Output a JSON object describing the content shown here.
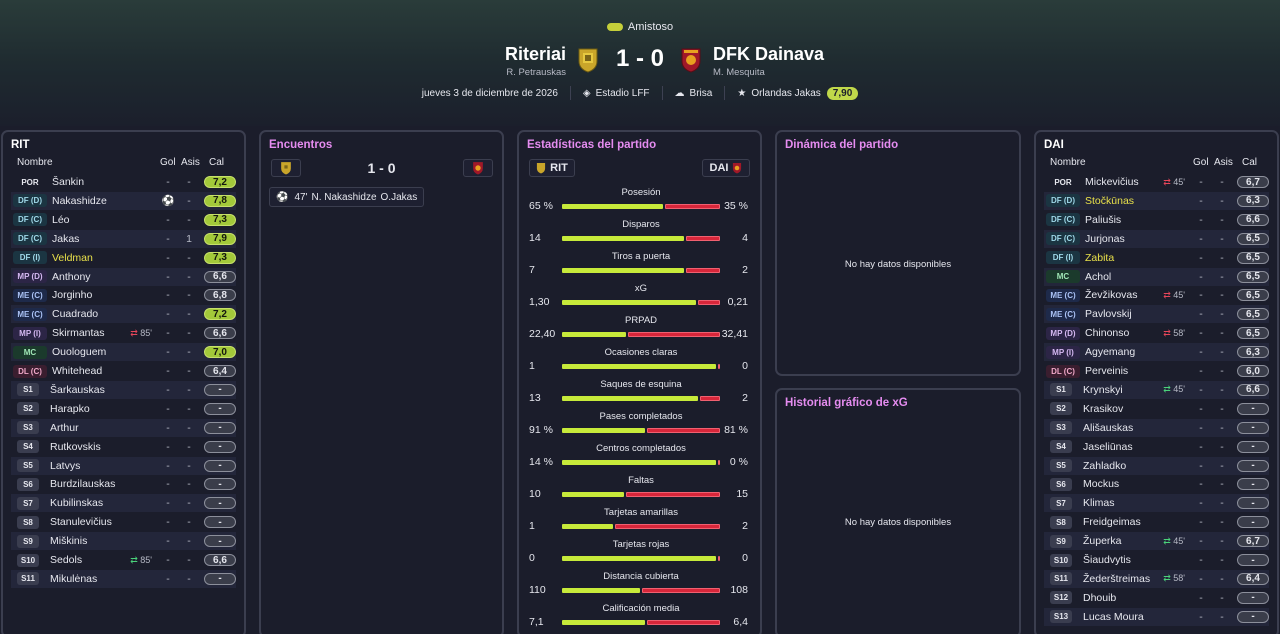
{
  "match": {
    "competition": "Amistoso",
    "home": {
      "name": "Riteriai",
      "manager": "R. Petrauskas",
      "short": "RIT"
    },
    "away": {
      "name": "DFK Dainava",
      "manager": "M. Mesquita",
      "short": "DAI"
    },
    "score": "1 - 0",
    "date": "jueves 3 de diciembre de 2026",
    "stadium": "Estadio LFF",
    "weather": "Brisa",
    "potm_name": "Orlandas Jakas",
    "potm_rating": "7,90"
  },
  "colors": {
    "accent": "#c7ea3a",
    "danger": "#d8263a",
    "title_pink": "#e58cf0"
  },
  "headers": {
    "name": "Nombre",
    "goals": "Gol",
    "assists": "Asis",
    "rating": "Cal"
  },
  "panels": {
    "home_title": "RIT",
    "away_title": "DAI",
    "events_title": "Encuentros",
    "stats_title": "Estadísticas del partido",
    "dynamics_title": "Dinámica del partido",
    "xg_title": "Historial gráfico de xG",
    "no_data": "No hay datos disponibles"
  },
  "events": {
    "score": "1 - 0",
    "items": [
      {
        "minute": "47'",
        "scorer": "N. Nakashidze",
        "assist": "O.Jakas"
      }
    ]
  },
  "home_players": [
    {
      "pos": "POR",
      "name": "Šankin",
      "goals": "-",
      "assists": "-",
      "rating": "7,2"
    },
    {
      "pos": "DF (D)",
      "name": "Nakashidze",
      "goals": "",
      "assists": "-",
      "rating": "7,8",
      "goal_icon": true
    },
    {
      "pos": "DF (C)",
      "name": "Léo",
      "goals": "-",
      "assists": "-",
      "rating": "7,3"
    },
    {
      "pos": "DF (C)",
      "name": "Jakas",
      "goals": "-",
      "assists": "1",
      "rating": "7,9"
    },
    {
      "pos": "DF (I)",
      "name": "Veldman",
      "goals": "-",
      "assists": "-",
      "rating": "7,3",
      "yellow": true
    },
    {
      "pos": "MP (D)",
      "name": "Anthony",
      "goals": "-",
      "assists": "-",
      "rating": "6,6"
    },
    {
      "pos": "ME (C)",
      "name": "Jorginho",
      "goals": "-",
      "assists": "-",
      "rating": "6,8"
    },
    {
      "pos": "ME (C)",
      "name": "Cuadrado",
      "goals": "-",
      "assists": "-",
      "rating": "7,2"
    },
    {
      "pos": "MP (I)",
      "name": "Skirmantas",
      "goals": "-",
      "assists": "-",
      "rating": "6,6",
      "sub": "85'",
      "sub_dir": "out"
    },
    {
      "pos": "MC",
      "name": "Ouologuem",
      "goals": "-",
      "assists": "-",
      "rating": "7,0"
    },
    {
      "pos": "DL (C)",
      "name": "Whitehead",
      "goals": "-",
      "assists": "-",
      "rating": "6,4"
    },
    {
      "pos": "S1",
      "name": "Šarkauskas",
      "goals": "-",
      "assists": "-",
      "rating": "-"
    },
    {
      "pos": "S2",
      "name": "Harapko",
      "goals": "-",
      "assists": "-",
      "rating": "-"
    },
    {
      "pos": "S3",
      "name": "Arthur",
      "goals": "-",
      "assists": "-",
      "rating": "-"
    },
    {
      "pos": "S4",
      "name": "Rutkovskis",
      "goals": "-",
      "assists": "-",
      "rating": "-"
    },
    {
      "pos": "S5",
      "name": "Latvys",
      "goals": "-",
      "assists": "-",
      "rating": "-"
    },
    {
      "pos": "S6",
      "name": "Burdzilauskas",
      "goals": "-",
      "assists": "-",
      "rating": "-"
    },
    {
      "pos": "S7",
      "name": "Kubilinskas",
      "goals": "-",
      "assists": "-",
      "rating": "-"
    },
    {
      "pos": "S8",
      "name": "Stanulevičius",
      "goals": "-",
      "assists": "-",
      "rating": "-"
    },
    {
      "pos": "S9",
      "name": "Miškinis",
      "goals": "-",
      "assists": "-",
      "rating": "-"
    },
    {
      "pos": "S10",
      "name": "Sedols",
      "goals": "-",
      "assists": "-",
      "rating": "6,6",
      "sub": "85'",
      "sub_dir": "in"
    },
    {
      "pos": "S11",
      "name": "Mikulėnas",
      "goals": "-",
      "assists": "-",
      "rating": "-"
    }
  ],
  "away_players": [
    {
      "pos": "POR",
      "name": "Mickevičius",
      "goals": "-",
      "assists": "-",
      "rating": "6,7",
      "sub": "45'",
      "sub_dir": "out"
    },
    {
      "pos": "DF (D)",
      "name": "Stočkūnas",
      "goals": "-",
      "assists": "-",
      "rating": "6,3",
      "yellow": true
    },
    {
      "pos": "DF (C)",
      "name": "Paliušis",
      "goals": "-",
      "assists": "-",
      "rating": "6,6"
    },
    {
      "pos": "DF (C)",
      "name": "Jurjonas",
      "goals": "-",
      "assists": "-",
      "rating": "6,5"
    },
    {
      "pos": "DF (I)",
      "name": "Zabita",
      "goals": "-",
      "assists": "-",
      "rating": "6,5",
      "yellow": true
    },
    {
      "pos": "MC",
      "name": "Achol",
      "goals": "-",
      "assists": "-",
      "rating": "6,5"
    },
    {
      "pos": "ME (C)",
      "name": "Ževžikovas",
      "goals": "-",
      "assists": "-",
      "rating": "6,5",
      "sub": "45'",
      "sub_dir": "out"
    },
    {
      "pos": "ME (C)",
      "name": "Pavlovskij",
      "goals": "-",
      "assists": "-",
      "rating": "6,5"
    },
    {
      "pos": "MP (D)",
      "name": "Chinonso",
      "goals": "-",
      "assists": "-",
      "rating": "6,5",
      "sub": "58'",
      "sub_dir": "out"
    },
    {
      "pos": "MP (I)",
      "name": "Agyemang",
      "goals": "-",
      "assists": "-",
      "rating": "6,3"
    },
    {
      "pos": "DL (C)",
      "name": "Perveinis",
      "goals": "-",
      "assists": "-",
      "rating": "6,0"
    },
    {
      "pos": "S1",
      "name": "Krynskyi",
      "goals": "-",
      "assists": "-",
      "rating": "6,6",
      "sub": "45'",
      "sub_dir": "in"
    },
    {
      "pos": "S2",
      "name": "Krasikov",
      "goals": "-",
      "assists": "-",
      "rating": "-"
    },
    {
      "pos": "S3",
      "name": "Ališauskas",
      "goals": "-",
      "assists": "-",
      "rating": "-"
    },
    {
      "pos": "S4",
      "name": "Jaseliūnas",
      "goals": "-",
      "assists": "-",
      "rating": "-"
    },
    {
      "pos": "S5",
      "name": "Zahladko",
      "goals": "-",
      "assists": "-",
      "rating": "-"
    },
    {
      "pos": "S6",
      "name": "Mockus",
      "goals": "-",
      "assists": "-",
      "rating": "-"
    },
    {
      "pos": "S7",
      "name": "Klimas",
      "goals": "-",
      "assists": "-",
      "rating": "-"
    },
    {
      "pos": "S8",
      "name": "Freidgeimas",
      "goals": "-",
      "assists": "-",
      "rating": "-"
    },
    {
      "pos": "S9",
      "name": "Župerka",
      "goals": "-",
      "assists": "-",
      "rating": "6,7",
      "sub": "45'",
      "sub_dir": "in"
    },
    {
      "pos": "S10",
      "name": "Šiaudvytis",
      "goals": "-",
      "assists": "-",
      "rating": "-"
    },
    {
      "pos": "S11",
      "name": "Žederštreimas",
      "goals": "-",
      "assists": "-",
      "rating": "6,4",
      "sub": "58'",
      "sub_dir": "in"
    },
    {
      "pos": "S12",
      "name": "Dhouib",
      "goals": "-",
      "assists": "-",
      "rating": "-"
    },
    {
      "pos": "S13",
      "name": "Lucas Moura",
      "goals": "-",
      "assists": "-",
      "rating": "-"
    }
  ],
  "stats": [
    {
      "label": "Posesión",
      "home": "65 %",
      "away": "35 %",
      "home_share": 0.65
    },
    {
      "label": "Disparos",
      "home": "14",
      "away": "4",
      "home_share": 0.78
    },
    {
      "label": "Tiros a puerta",
      "home": "7",
      "away": "2",
      "home_share": 0.78
    },
    {
      "label": "xG",
      "home": "1,30",
      "away": "0,21",
      "home_share": 0.86
    },
    {
      "label": "PRPAD",
      "home": "22,40",
      "away": "32,41",
      "home_share": 0.41
    },
    {
      "label": "Ocasiones claras",
      "home": "1",
      "away": "0",
      "home_share": 0.99
    },
    {
      "label": "Saques de esquina",
      "home": "13",
      "away": "2",
      "home_share": 0.87
    },
    {
      "label": "Pases completados",
      "home": "91 %",
      "away": "81 %",
      "home_share": 0.53
    },
    {
      "label": "Centros completados",
      "home": "14 %",
      "away": "0 %",
      "home_share": 0.99
    },
    {
      "label": "Faltas",
      "home": "10",
      "away": "15",
      "home_share": 0.4
    },
    {
      "label": "Tarjetas amarillas",
      "home": "1",
      "away": "2",
      "home_share": 0.33
    },
    {
      "label": "Tarjetas rojas",
      "home": "0",
      "away": "0",
      "home_share": 0.99
    },
    {
      "label": "Distancia cubierta",
      "home": "110",
      "away": "108",
      "home_share": 0.5
    },
    {
      "label": "Calificación media",
      "home": "7,1",
      "away": "6,4",
      "home_share": 0.53
    }
  ]
}
